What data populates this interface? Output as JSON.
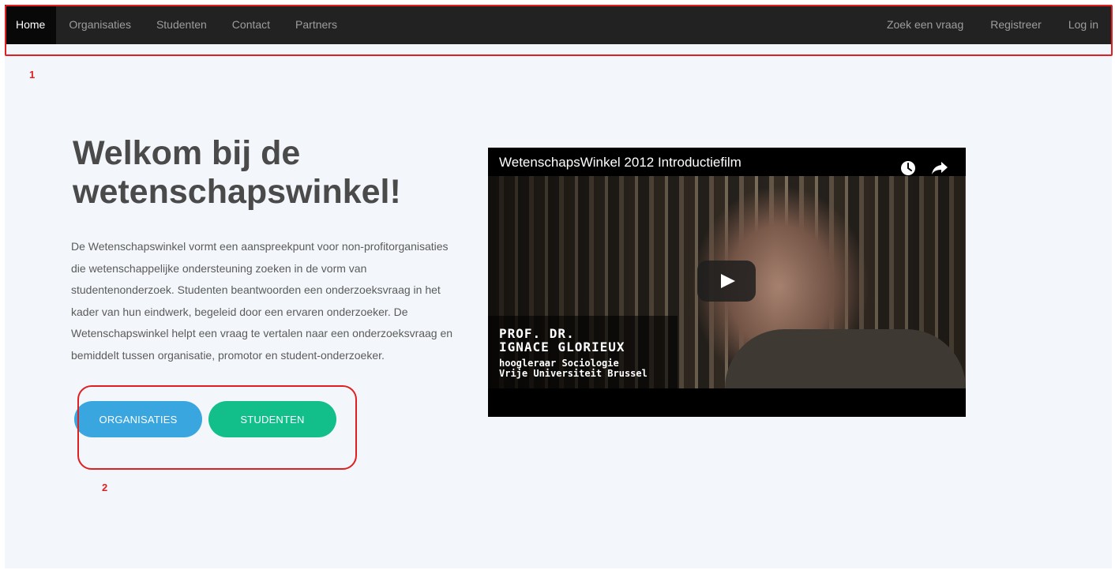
{
  "navbar": {
    "left_items": [
      {
        "label": "Home",
        "active": true
      },
      {
        "label": "Organisaties"
      },
      {
        "label": "Studenten"
      },
      {
        "label": "Contact"
      },
      {
        "label": "Partners"
      }
    ],
    "right_items": [
      {
        "label": "Zoek een vraag"
      },
      {
        "label": "Registreer"
      },
      {
        "label": "Log in"
      }
    ]
  },
  "annotations": [
    {
      "label": "1"
    },
    {
      "label": "2"
    }
  ],
  "hero": {
    "title": "Welkom bij de wetenschapswinkel!",
    "description": "De Wetenschapswinkel vormt een aanspreekpunt voor non-profitorganisaties die wetenschappelijke ondersteuning zoeken in de vorm van studentenonderzoek. Studenten beantwoorden een onderzoeksvraag in het kader van hun eindwerk, begeleid door een ervaren onderzoeker. De Wetenschapswinkel helpt een vraag te vertalen naar een onderzoeksvraag en bemiddelt tussen organisatie, promotor en student-onderzoeker.",
    "buttons": {
      "organisaties": "ORGANISATIES",
      "studenten": "STUDENTEN"
    }
  },
  "video": {
    "title": "WetenschapsWinkel 2012 Introductiefilm",
    "icons": [
      "clock-icon",
      "share-icon",
      "play-icon"
    ],
    "lower_third": {
      "name_line_1": "PROF. DR.",
      "name_line_2": "IGNACE GLORIEUX",
      "role_line_1": "hoogleraar Sociologie",
      "role_line_2": "Vrije Universiteit Brussel"
    }
  },
  "colors": {
    "navbar_bg": "#222222",
    "page_bg": "#f3f6fa",
    "btn_organisaties": "#3aa6e0",
    "btn_studenten": "#12bf8b",
    "annotation": "#e02020"
  }
}
